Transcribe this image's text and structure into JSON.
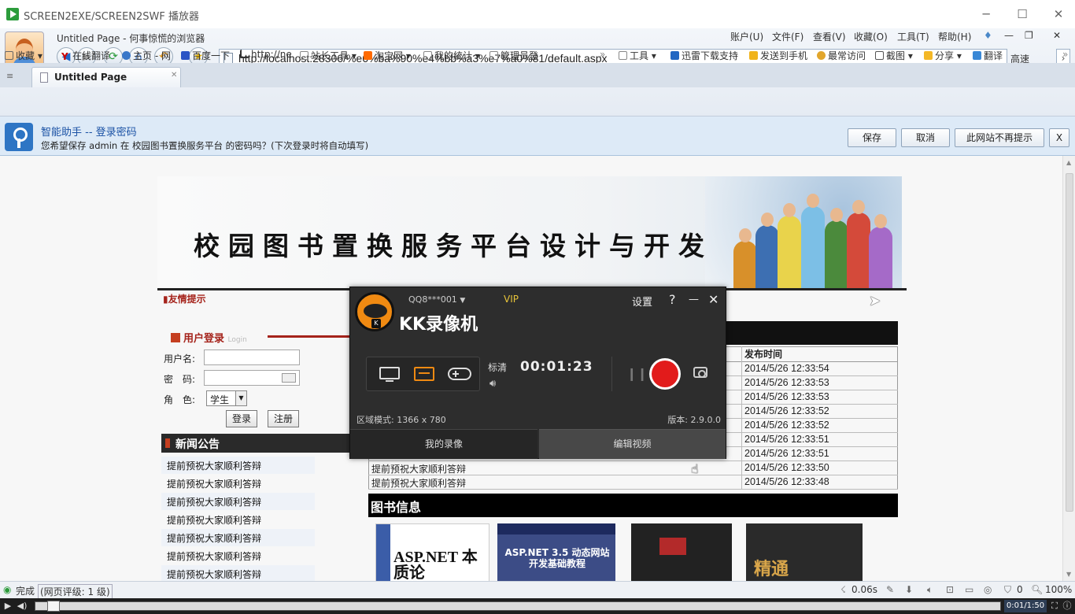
{
  "window": {
    "title": "SCREEN2EXE/SCREEN2SWF 播放器",
    "min": "─",
    "max": "☐",
    "close": "✕"
  },
  "browser": {
    "page_title": "Untitled Page - 何事惊慌的浏览器",
    "menu": [
      "账户(U)",
      "文件(F)",
      "查看(V)",
      "收藏(O)",
      "工具(T)",
      "帮助(H)"
    ],
    "url": "http://localhost:28306/%e6%ba%90%e4%bb%a3%e7%a0%81/default.aspx",
    "speed_label": "高速",
    "favorites": [
      "收藏",
      "在线翻译",
      "主页 - 网",
      "百度一下",
      "http://ne",
      "站长工具",
      "淘宝网",
      "我的統计",
      "管理员登"
    ],
    "tools": [
      "工具",
      "迅雷下载支持",
      "发送到手机",
      "最常访问",
      "截图",
      "分享",
      "翻译"
    ],
    "tab_label": "Untitled Page"
  },
  "notify": {
    "heading": "智能助手 -- 登录密码",
    "message": "您希望保存 admin 在 校园图书置换服务平台 的密码吗？(下次登录时将自动填写)",
    "save": "保存",
    "cancel": "取消",
    "never": "此网站不再提示",
    "close": "X"
  },
  "site": {
    "banner_title": "校园图书置换服务平台设计与开发",
    "friendly_tip": "友情提示",
    "login_title": "用户登录",
    "login_sub": "Login",
    "username_label": "用户名:",
    "password_label": "密　码:",
    "role_label": "角　色:",
    "role_value": "学生",
    "login_btn": "登录",
    "register_btn": "注册",
    "news_title": "新闻公告",
    "news_items": [
      "提前预祝大家顺利答辩",
      "提前预祝大家顺利答辩",
      "提前预祝大家顺利答辩",
      "提前预祝大家顺利答辩",
      "提前预祝大家顺利答辩",
      "提前预祝大家顺利答辩",
      "提前预祝大家顺利答辩"
    ],
    "table_header_time": "发布时间",
    "rows": [
      {
        "title": "",
        "time": "2014/5/26 12:33:54"
      },
      {
        "title": "",
        "time": "2014/5/26 12:33:53"
      },
      {
        "title": "",
        "time": "2014/5/26 12:33:53"
      },
      {
        "title": "",
        "time": "2014/5/26 12:33:52"
      },
      {
        "title": "",
        "time": "2014/5/26 12:33:52"
      },
      {
        "title": "",
        "time": "2014/5/26 12:33:51"
      },
      {
        "title": "",
        "time": "2014/5/26 12:33:51"
      },
      {
        "title": "提前预祝大家顺利答辩",
        "time": "2014/5/26 12:33:50"
      },
      {
        "title": "提前预祝大家顺利答辩",
        "time": "2014/5/26 12:33:48"
      }
    ],
    "books_title": "图书信息",
    "books": [
      {
        "title": "ASP.NET 本质论"
      },
      {
        "title": "ASP.NET 3.5 动态网站开发基础教程"
      },
      {
        "title": ""
      },
      {
        "title": "精通"
      }
    ]
  },
  "kk": {
    "account": "QQ8***001",
    "vip": "VIP",
    "brand": "KK录像机",
    "settings": "设置",
    "help": "?",
    "minimize": "—",
    "close": "✕",
    "quality": "标清",
    "timer": "00:01:23",
    "region_mode": "区域模式: 1366 x 780",
    "version": "版本: 2.9.0.0",
    "my_videos": "我的录像",
    "edit_video": "编辑视频"
  },
  "status": {
    "done": "完成",
    "rating": "(网页评级: 1 级)",
    "load_time": "0.06s",
    "count": "0",
    "zoom": "100%"
  },
  "player": {
    "time": "0:01/1:50"
  }
}
